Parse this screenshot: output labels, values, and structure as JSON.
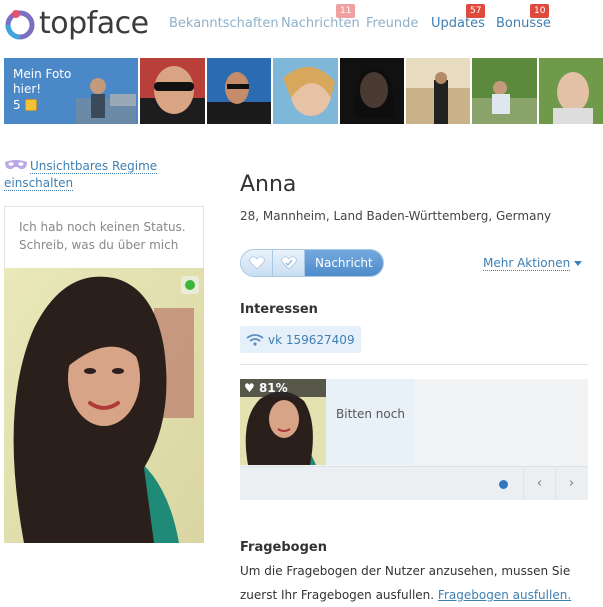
{
  "brand": {
    "name": "topface"
  },
  "nav": [
    {
      "label": "Bekanntschaften",
      "badge": ""
    },
    {
      "label": "Nachrichten",
      "badge": "11"
    },
    {
      "label": "Freunde",
      "badge": ""
    },
    {
      "label": "Updates",
      "badge": "57"
    },
    {
      "label": "Bonusse",
      "badge": "10"
    }
  ],
  "strip": {
    "promo_line1": "Mein Foto",
    "promo_line2": "hier!",
    "promo_price": "5"
  },
  "left": {
    "invisible_line1": "Unsichtbares Regime",
    "invisible_line2": "einschalten",
    "status_placeholder": "Ich hab noch keinen Status. Schreib, was du über mich"
  },
  "profile": {
    "name": "Anna",
    "info": "28,  Mannheim, Land Baden-Württemberg, Germany",
    "message_button": "Nachricht",
    "more_actions": "Mehr Aktionen"
  },
  "interests": {
    "title": "Interessen",
    "chip": "vk 159627409"
  },
  "match": {
    "percent": "81%",
    "text": "Bitten noch"
  },
  "questionnaire": {
    "title": "Fragebogen",
    "text": "Um die Fragebogen der Nutzer anzusehen, mussen Sie zuerst Ihr Fragebogen ausfullen.",
    "link": "Fragebogen ausfullen."
  },
  "colors": {
    "accent": "#4a88c7",
    "link": "#3f7fb3",
    "badge_red": "#e04a3c",
    "badge_pink": "#f0a0a0",
    "online": "#3ab73a"
  }
}
